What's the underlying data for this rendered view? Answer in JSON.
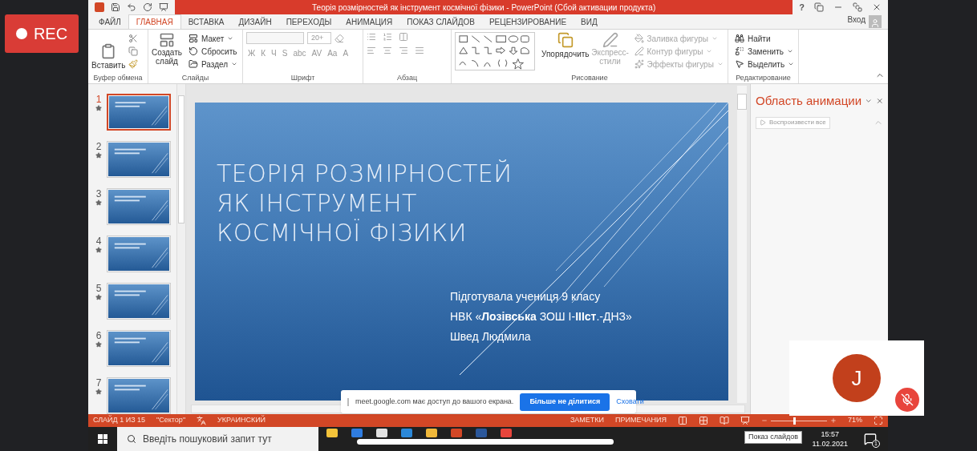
{
  "recording": {
    "label": "REC"
  },
  "window": {
    "title": "Теорія розмірностей як інструмент космічної фізики -  PowerPoint (Сбой активации продукта)",
    "help": "?",
    "sign_in": "Вход"
  },
  "tabs": [
    {
      "label": "ФАЙЛ",
      "selected": false
    },
    {
      "label": "ГЛАВНАЯ",
      "selected": true
    },
    {
      "label": "ВСТАВКА",
      "selected": false
    },
    {
      "label": "ДИЗАЙН",
      "selected": false
    },
    {
      "label": "ПЕРЕХОДЫ",
      "selected": false
    },
    {
      "label": "АНИМАЦИЯ",
      "selected": false
    },
    {
      "label": "ПОКАЗ СЛАЙДОВ",
      "selected": false
    },
    {
      "label": "РЕЦЕНЗИРОВАНИЕ",
      "selected": false
    },
    {
      "label": "ВИД",
      "selected": false
    }
  ],
  "ribbon": {
    "clipboard": {
      "label": "Буфер обмена",
      "paste": "Вставить"
    },
    "slides": {
      "label": "Слайды",
      "new_slide": "Создать слайд",
      "items": [
        "Макет",
        "Сбросить",
        "Раздел"
      ]
    },
    "font": {
      "label": "Шрифт",
      "size": "20+",
      "format_buttons": [
        "Ж",
        "К",
        "Ч",
        "S",
        "abc",
        "AV",
        "Aa",
        "A"
      ]
    },
    "paragraph": {
      "label": "Абзац"
    },
    "drawing": {
      "label": "Рисование",
      "arrange": "Упорядочить",
      "quick_styles": {
        "label": "Экспресс-стили",
        "disabled": true
      },
      "items": [
        {
          "label": "Заливка фигуры",
          "disabled": true
        },
        {
          "label": "Контур фигуры",
          "disabled": true
        },
        {
          "label": "Эффекты фигуры",
          "disabled": true
        }
      ]
    },
    "editing": {
      "label": "Редактирование",
      "items": [
        "Найти",
        "Заменить",
        "Выделить"
      ]
    }
  },
  "thumbnails": [
    {
      "number": "1",
      "selected": true
    },
    {
      "number": "2",
      "selected": false
    },
    {
      "number": "3",
      "selected": false
    },
    {
      "number": "4",
      "selected": false
    },
    {
      "number": "5",
      "selected": false
    },
    {
      "number": "6",
      "selected": false
    },
    {
      "number": "7",
      "selected": false
    }
  ],
  "slide": {
    "title": "ТЕОРІЯ РОЗМІРНОСТЕЙ ЯК ІНСТРУМЕНТ КОСМІЧНОЇ ФІЗИКИ",
    "subtitle": [
      "Підготувала учениця 9 класу",
      "НВК «**Лозівська** ЗОШ І-**ІІІст**.-ДНЗ»",
      "Швед Людмила"
    ]
  },
  "animation_pane": {
    "title": "Область анимации",
    "play_all": "Воспроизвести все"
  },
  "status_bar": {
    "slide": "СЛАЙД 1 ИЗ 15",
    "theme": "\"Сектор\"",
    "language": "УКРАИНСКИЙ",
    "notes": "ЗАМЕТКИ",
    "comments": "ПРИМЕЧАНИЯ",
    "zoom": {
      "level": 0.4,
      "reading": "71%"
    }
  },
  "share_banner": {
    "text": "meet.google.com має доступ до вашого екрана.",
    "stop": "Більше не ділитися",
    "hide": "Сховати"
  },
  "participant": {
    "initial": "J",
    "muted": true
  },
  "tooltip": "Показ слайдов",
  "taskbar": {
    "search_placeholder": "Введіть пошуковий запит тут",
    "time": "15:57",
    "date": "11.02.2021",
    "notifications": "1"
  }
}
